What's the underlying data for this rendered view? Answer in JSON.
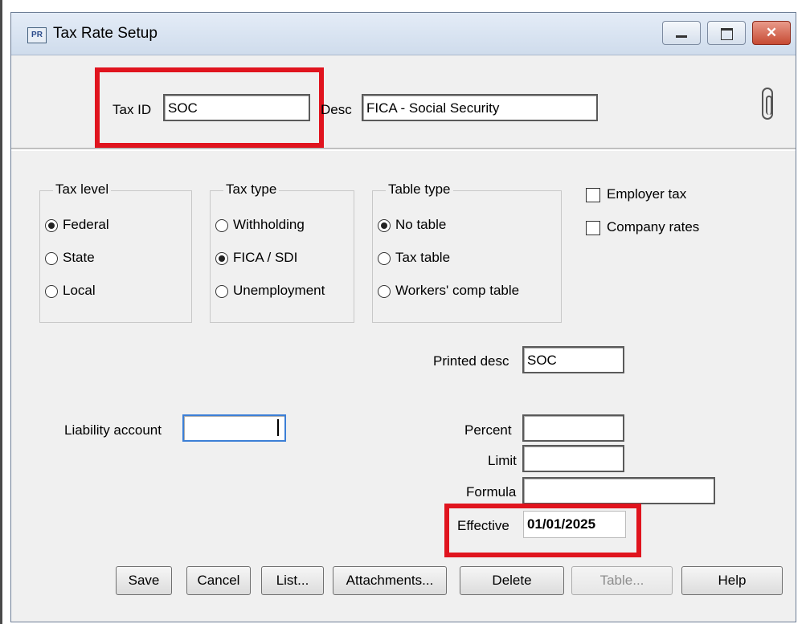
{
  "window": {
    "title": "Tax Rate Setup",
    "app_badge": "PR",
    "close_glyph": "✕"
  },
  "header": {
    "tax_id_label": "Tax ID",
    "tax_id_value": "SOC",
    "desc_label": "Desc",
    "desc_value": "FICA - Social Security",
    "attachment_icon": "paperclip-icon"
  },
  "tax_level": {
    "legend": "Tax level",
    "options": [
      {
        "label": "Federal",
        "selected": true
      },
      {
        "label": "State",
        "selected": false
      },
      {
        "label": "Local",
        "selected": false
      }
    ]
  },
  "tax_type": {
    "legend": "Tax type",
    "options": [
      {
        "label": "Withholding",
        "selected": false
      },
      {
        "label": "FICA / SDI",
        "selected": true
      },
      {
        "label": "Unemployment",
        "selected": false
      }
    ]
  },
  "table_type": {
    "legend": "Table type",
    "options": [
      {
        "label": "No table",
        "selected": true
      },
      {
        "label": "Tax table",
        "selected": false
      },
      {
        "label": "Workers' comp table",
        "selected": false
      }
    ]
  },
  "checkboxes": [
    {
      "label": "Employer tax",
      "checked": false
    },
    {
      "label": "Company rates",
      "checked": false
    }
  ],
  "fields": {
    "printed_desc_label": "Printed desc",
    "printed_desc_value": "SOC",
    "liability_account_label": "Liability account",
    "liability_account_value": "",
    "percent_label": "Percent",
    "percent_value": "",
    "limit_label": "Limit",
    "limit_value": "",
    "formula_label": "Formula",
    "formula_value": "",
    "effective_label": "Effective",
    "effective_value": "01/01/2025"
  },
  "buttons": {
    "save": "Save",
    "cancel": "Cancel",
    "list": "List...",
    "attachments": "Attachments...",
    "delete": "Delete",
    "table": "Table...",
    "help": "Help"
  },
  "colors": {
    "highlight": "#e0141e",
    "focus_border": "#3c7fd6"
  }
}
